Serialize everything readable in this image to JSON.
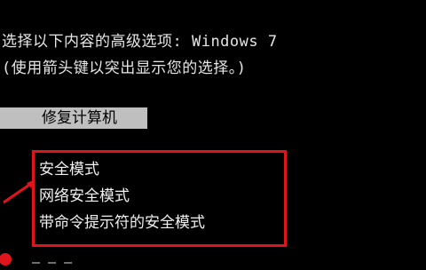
{
  "boot_menu": {
    "header_line1": "选择以下内容的高级选项: Windows 7",
    "header_line2": "(使用箭头键以突出显示您的选择。)",
    "selected_item": "修复计算机",
    "options": [
      "安全模式",
      "网络安全模式",
      "带命令提示符的安全模式"
    ],
    "cut_line": "—   —  —"
  },
  "colors": {
    "background": "#000000",
    "text": "#e6e6e6",
    "selection": "#bfbfbf",
    "annotation": "#e0151c"
  },
  "annotation": {
    "icon": "red-arrow-icon"
  }
}
